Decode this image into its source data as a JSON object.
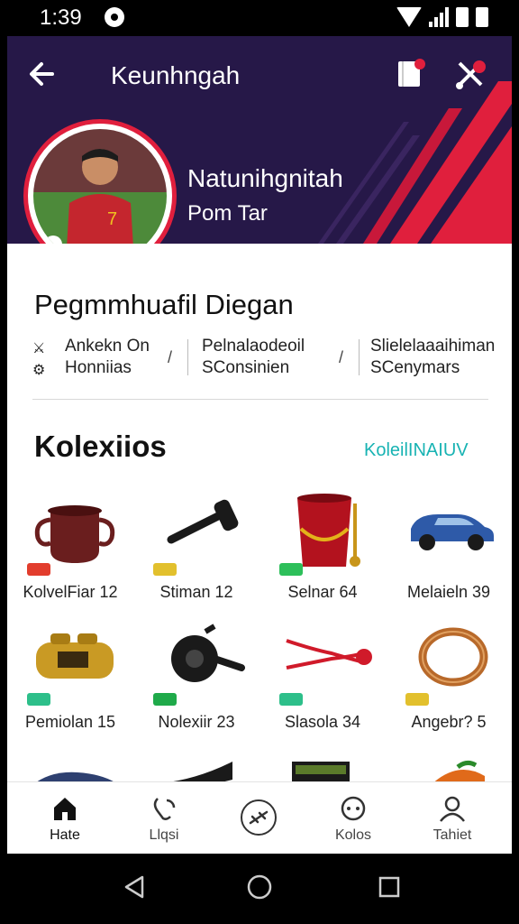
{
  "status_bar": {
    "time": "1:39"
  },
  "header": {
    "title": "Keunhngah",
    "profile_name": "Natunihgnitah",
    "profile_sub": "Pom Tar",
    "colors": {
      "background": "#261848",
      "accent": "#e01f3d"
    }
  },
  "details": {
    "title": "Pegmmhuafil Diegan",
    "col1_line1": "Ankekn On",
    "col1_line2": "Honniias",
    "col2_line1": "Pelnalaodeoil",
    "col2_line2": "SConsinien",
    "col3_line1": "Slielelaaaihiman",
    "col3_line2": "SCenymars"
  },
  "collection": {
    "title": "Kolexiios",
    "link": "KoleilINAIUV",
    "items": [
      {
        "label": "KolvelFiar 12",
        "icon": "pot-icon",
        "badge": "#e23d2d"
      },
      {
        "label": "Stiman 12",
        "icon": "hammer-icon",
        "badge": "#e2c02d"
      },
      {
        "label": "Selnar 64",
        "icon": "bucket-icon",
        "badge": "#2dbf5a"
      },
      {
        "label": "Melaieln 39",
        "icon": "car-icon",
        "badge": ""
      },
      {
        "label": "Pemiolan 15",
        "icon": "cylinder-icon",
        "badge": "#2dbf8a"
      },
      {
        "label": "Nolexiir 23",
        "icon": "weight-icon",
        "badge": "#1faa4a"
      },
      {
        "label": "Slasola 34",
        "icon": "rope-icon",
        "badge": "#2dbf8a"
      },
      {
        "label": "Angebr? 5",
        "icon": "ring-icon",
        "badge": "#e2c02d"
      }
    ]
  },
  "bottom_nav": {
    "items": [
      {
        "label": "Hate",
        "icon": "home-icon"
      },
      {
        "label": "Llqsi",
        "icon": "phone-icon"
      },
      {
        "label": "",
        "icon": "plane-icon"
      },
      {
        "label": "Kolos",
        "icon": "face-icon"
      },
      {
        "label": "Tahiet",
        "icon": "profile-icon"
      }
    ]
  }
}
